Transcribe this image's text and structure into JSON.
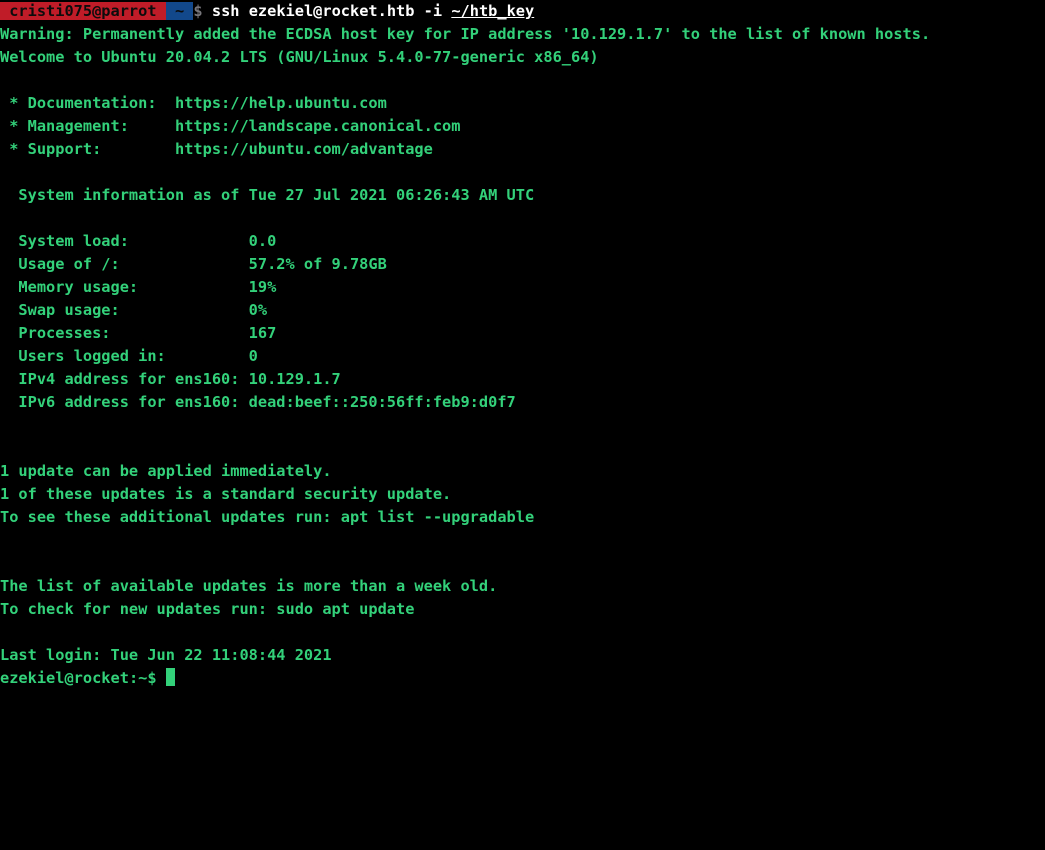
{
  "prompt": {
    "user_host": " cristi075@parrot ",
    "arrow1a": "",
    "cwd": " ~ ",
    "arrow2a": "",
    "dollar": "$",
    "cmd_prefix": "ssh ",
    "cmd_target": "ezekiel@rocket.htb -i ",
    "cmd_key": "~/htb_key"
  },
  "motd": {
    "warn": "Warning: Permanently added the ECDSA host key for IP address '10.129.1.7' to the list of known hosts.",
    "welcome": "Welcome to Ubuntu 20.04.2 LTS (GNU/Linux 5.4.0-77-generic x86_64)",
    "l_doc": " * Documentation:  https://help.ubuntu.com",
    "l_mgmt": " * Management:     https://landscape.canonical.com",
    "l_support": " * Support:        https://ubuntu.com/advantage",
    "sysinfo_hdr": "  System information as of Tue 27 Jul 2021 06:26:43 AM UTC",
    "s_load": "  System load:             0.0",
    "s_usage": "  Usage of /:              57.2% of 9.78GB",
    "s_mem": "  Memory usage:            19%",
    "s_swap": "  Swap usage:              0%",
    "s_proc": "  Processes:               167",
    "s_users": "  Users logged in:         0",
    "s_ipv4": "  IPv4 address for ens160: 10.129.1.7",
    "s_ipv6": "  IPv6 address for ens160: dead:beef::250:56ff:feb9:d0f7",
    "upd1": "1 update can be applied immediately.",
    "upd2": "1 of these updates is a standard security update.",
    "upd3": "To see these additional updates run: apt list --upgradable",
    "old1": "The list of available updates is more than a week old.",
    "old2": "To check for new updates run: sudo apt update",
    "lastlogin": "Last login: Tue Jun 22 11:08:44 2021",
    "remote_prompt_a": "ezekiel@rocket",
    "remote_prompt_b": ":",
    "remote_prompt_c": "~",
    "remote_prompt_d": "$ "
  }
}
